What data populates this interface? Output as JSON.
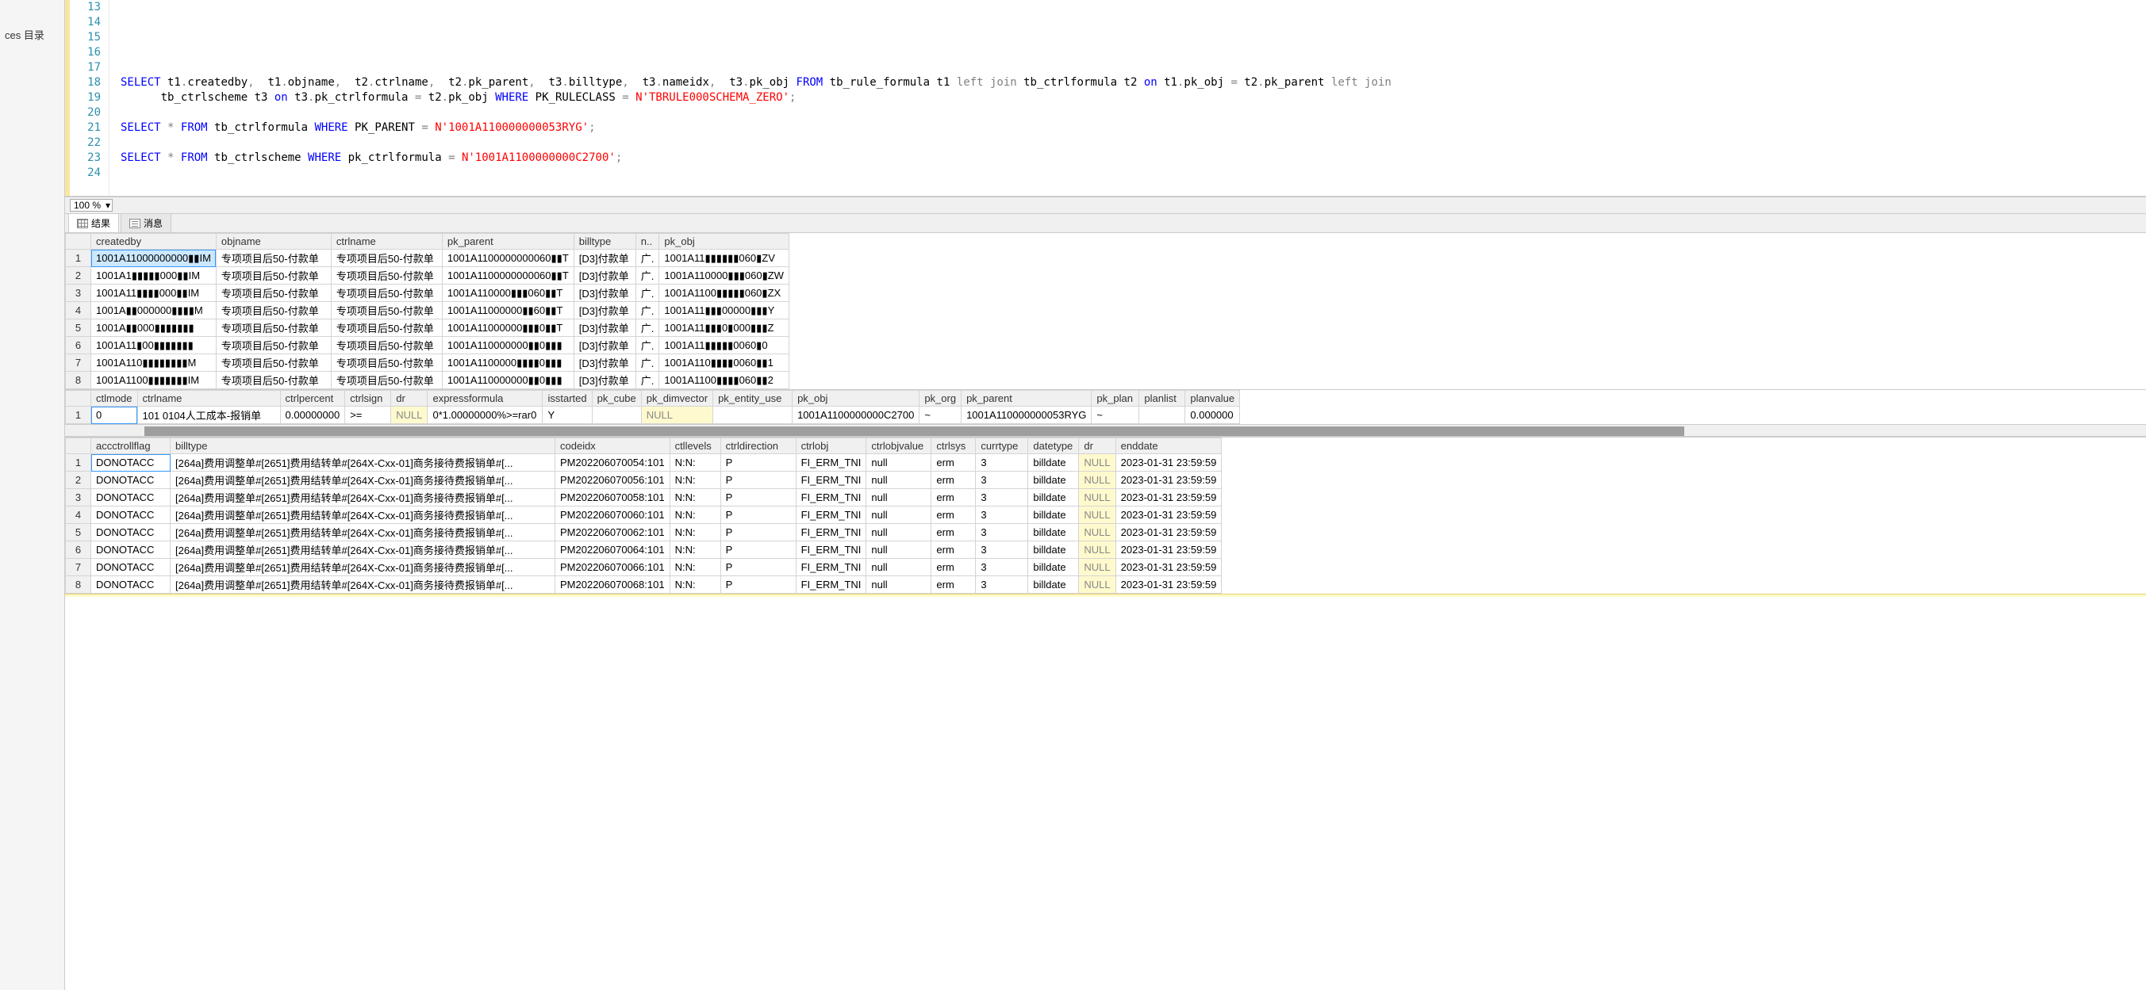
{
  "sidebar": {
    "item": "ces 目录"
  },
  "editor": {
    "first_line_no": 13,
    "lines": [
      "",
      "",
      "",
      "",
      "",
      {
        "type": "sql",
        "tokens": [
          {
            "k": "kw",
            "t": "SELECT"
          },
          {
            "t": " t1"
          },
          {
            "k": "op",
            "t": "."
          },
          {
            "t": "createdby"
          },
          {
            "k": "op",
            "t": ","
          },
          {
            "t": "  t1"
          },
          {
            "k": "op",
            "t": "."
          },
          {
            "t": "objname"
          },
          {
            "k": "op",
            "t": ","
          },
          {
            "t": "  t2"
          },
          {
            "k": "op",
            "t": "."
          },
          {
            "t": "ctrlname"
          },
          {
            "k": "op",
            "t": ","
          },
          {
            "t": "  t2"
          },
          {
            "k": "op",
            "t": "."
          },
          {
            "t": "pk_parent"
          },
          {
            "k": "op",
            "t": ","
          },
          {
            "t": "  t3"
          },
          {
            "k": "op",
            "t": "."
          },
          {
            "t": "billtype"
          },
          {
            "k": "op",
            "t": ","
          },
          {
            "t": "  t3"
          },
          {
            "k": "op",
            "t": "."
          },
          {
            "t": "nameidx"
          },
          {
            "k": "op",
            "t": ","
          },
          {
            "t": "  t3"
          },
          {
            "k": "op",
            "t": "."
          },
          {
            "t": "pk_obj "
          },
          {
            "k": "kw",
            "t": "FROM"
          },
          {
            "t": " tb_rule_formula t1 "
          },
          {
            "k": "op",
            "t": "left join"
          },
          {
            "t": " tb_ctrlformula t2 "
          },
          {
            "k": "kw",
            "t": "on"
          },
          {
            "t": " t1"
          },
          {
            "k": "op",
            "t": "."
          },
          {
            "t": "pk_obj "
          },
          {
            "k": "op",
            "t": "="
          },
          {
            "t": " t2"
          },
          {
            "k": "op",
            "t": "."
          },
          {
            "t": "pk_parent "
          },
          {
            "k": "op",
            "t": "left join"
          }
        ]
      },
      {
        "type": "cont",
        "tokens": [
          {
            "t": "      tb_ctrlscheme t3 "
          },
          {
            "k": "kw",
            "t": "on"
          },
          {
            "t": " t3"
          },
          {
            "k": "op",
            "t": "."
          },
          {
            "t": "pk_ctrlformula "
          },
          {
            "k": "op",
            "t": "="
          },
          {
            "t": " t2"
          },
          {
            "k": "op",
            "t": "."
          },
          {
            "t": "pk_obj "
          },
          {
            "k": "kw",
            "t": "WHERE"
          },
          {
            "t": " PK_RULECLASS "
          },
          {
            "k": "op",
            "t": "="
          },
          {
            "t": " "
          },
          {
            "k": "str",
            "t": "N'TBRULE000SCHEMA_ZERO'"
          },
          {
            "k": "op",
            "t": ";"
          }
        ]
      },
      "",
      {
        "type": "sql",
        "tokens": [
          {
            "k": "kw",
            "t": "SELECT"
          },
          {
            "t": " "
          },
          {
            "k": "op",
            "t": "*"
          },
          {
            "t": " "
          },
          {
            "k": "kw",
            "t": "FROM"
          },
          {
            "t": " tb_ctrlformula "
          },
          {
            "k": "kw",
            "t": "WHERE"
          },
          {
            "t": " PK_PARENT "
          },
          {
            "k": "op",
            "t": "="
          },
          {
            "t": " "
          },
          {
            "k": "str",
            "t": "N'1001A110000000053RYG'"
          },
          {
            "k": "op",
            "t": ";"
          }
        ]
      },
      "",
      {
        "type": "sql",
        "tokens": [
          {
            "k": "kw",
            "t": "SELECT"
          },
          {
            "t": " "
          },
          {
            "k": "op",
            "t": "*"
          },
          {
            "t": " "
          },
          {
            "k": "kw",
            "t": "FROM"
          },
          {
            "t": " tb_ctrlscheme "
          },
          {
            "k": "kw",
            "t": "WHERE"
          },
          {
            "t": " pk_ctrlformula "
          },
          {
            "k": "op",
            "t": "="
          },
          {
            "t": " "
          },
          {
            "k": "str",
            "t": "N'1001A1100000000C2700'"
          },
          {
            "k": "op",
            "t": ";"
          }
        ]
      },
      "",
      ""
    ],
    "line19_in_gutter": 19,
    "zoom": "100 %"
  },
  "tabs": {
    "results": "结果",
    "messages": "消息"
  },
  "grid1": {
    "cols": [
      "createdby",
      "objname",
      "ctrlname",
      "pk_parent",
      "billtype",
      "n..",
      "pk_obj"
    ],
    "widths": [
      150,
      145,
      140,
      150,
      78,
      22,
      148
    ],
    "rows": [
      [
        "1001A11000000000▮▮IM",
        "专项项目后50-付款单",
        "专项项目后50-付款单",
        "1001A1100000000060▮▮T",
        "[D3]付款单",
        "广.",
        "1001A11▮▮▮▮▮▮060▮ZV"
      ],
      [
        "1001A1▮▮▮▮▮000▮▮IM",
        "专项项目后50-付款单",
        "专项项目后50-付款单",
        "1001A1100000000060▮▮T",
        "[D3]付款单",
        "广.",
        "1001A110000▮▮▮060▮ZW"
      ],
      [
        "1001A11▮▮▮▮000▮▮IM",
        "专项项目后50-付款单",
        "专项项目后50-付款单",
        "1001A110000▮▮▮060▮▮T",
        "[D3]付款单",
        "广.",
        "1001A1100▮▮▮▮▮060▮ZX"
      ],
      [
        "1001A▮▮000000▮▮▮▮M",
        "专项项目后50-付款单",
        "专项项目后50-付款单",
        "1001A11000000▮▮60▮▮T",
        "[D3]付款单",
        "广.",
        "1001A11▮▮▮00000▮▮▮Y"
      ],
      [
        "1001A▮▮000▮▮▮▮▮▮▮",
        "专项项目后50-付款单",
        "专项项目后50-付款单",
        "1001A11000000▮▮▮0▮▮T",
        "[D3]付款单",
        "广.",
        "1001A11▮▮▮0▮000▮▮▮Z"
      ],
      [
        "1001A11▮00▮▮▮▮▮▮▮",
        "专项项目后50-付款单",
        "专项项目后50-付款单",
        "1001A110000000▮▮0▮▮▮",
        "[D3]付款单",
        "广.",
        "1001A11▮▮▮▮▮0060▮0"
      ],
      [
        "1001A110▮▮▮▮▮▮▮▮M",
        "专项项目后50-付款单",
        "专项项目后50-付款单",
        "1001A1100000▮▮▮▮0▮▮▮",
        "[D3]付款单",
        "广.",
        "1001A110▮▮▮▮0060▮▮1"
      ],
      [
        "1001A1100▮▮▮▮▮▮▮IM",
        "专项项目后50-付款单",
        "专项项目后50-付款单",
        "1001A110000000▮▮0▮▮▮",
        "[D3]付款单",
        "广.",
        "1001A1100▮▮▮▮060▮▮2"
      ]
    ]
  },
  "grid2": {
    "cols": [
      "ctlmode",
      "ctrlname",
      "ctrlpercent",
      "ctrlsign",
      "dr",
      "expressformula",
      "isstarted",
      "pk_cube",
      "pk_dimvector",
      "pk_entity_use",
      "pk_obj",
      "pk_org",
      "pk_parent",
      "pk_plan",
      "planlist",
      "planvalue"
    ],
    "widths": [
      52,
      180,
      75,
      58,
      40,
      145,
      62,
      60,
      90,
      100,
      150,
      44,
      150,
      60,
      58,
      60
    ],
    "rows": [
      [
        "0",
        "101 0104人工成本-报销单",
        "0.00000000",
        ">=",
        "NULL",
        "0*1.00000000%>=rar0",
        "Y",
        "",
        "NULL",
        "",
        "1001A1100000000C2700",
        "~",
        "1001A110000000053RYG",
        "~",
        "",
        "0.000000"
      ]
    ]
  },
  "grid3": {
    "cols": [
      "accctrollflag",
      "billtype",
      "codeidx",
      "ctllevels",
      "ctrldirection",
      "ctrlobj",
      "ctrlobjvalue",
      "ctrlsys",
      "currtype",
      "datetype",
      "dr",
      "enddate"
    ],
    "widths": [
      100,
      485,
      134,
      64,
      95,
      80,
      82,
      56,
      66,
      64,
      40,
      130
    ],
    "rows": [
      [
        "DONOTACC",
        "[264a]费用调整单#[2651]费用结转单#[264X-Cxx-01]商务接待费报销单#[...",
        "PM202206070054:101",
        "N:N:",
        "P",
        "FI_ERM_TNI",
        "null",
        "erm",
        "3",
        "billdate",
        "NULL",
        "2023-01-31 23:59:59"
      ],
      [
        "DONOTACC",
        "[264a]费用调整单#[2651]费用结转单#[264X-Cxx-01]商务接待费报销单#[...",
        "PM202206070056:101",
        "N:N:",
        "P",
        "FI_ERM_TNI",
        "null",
        "erm",
        "3",
        "billdate",
        "NULL",
        "2023-01-31 23:59:59"
      ],
      [
        "DONOTACC",
        "[264a]费用调整单#[2651]费用结转单#[264X-Cxx-01]商务接待费报销单#[...",
        "PM202206070058:101",
        "N:N:",
        "P",
        "FI_ERM_TNI",
        "null",
        "erm",
        "3",
        "billdate",
        "NULL",
        "2023-01-31 23:59:59"
      ],
      [
        "DONOTACC",
        "[264a]费用调整单#[2651]费用结转单#[264X-Cxx-01]商务接待费报销单#[...",
        "PM202206070060:101",
        "N:N:",
        "P",
        "FI_ERM_TNI",
        "null",
        "erm",
        "3",
        "billdate",
        "NULL",
        "2023-01-31 23:59:59"
      ],
      [
        "DONOTACC",
        "[264a]费用调整单#[2651]费用结转单#[264X-Cxx-01]商务接待费报销单#[...",
        "PM202206070062:101",
        "N:N:",
        "P",
        "FI_ERM_TNI",
        "null",
        "erm",
        "3",
        "billdate",
        "NULL",
        "2023-01-31 23:59:59"
      ],
      [
        "DONOTACC",
        "[264a]费用调整单#[2651]费用结转单#[264X-Cxx-01]商务接待费报销单#[...",
        "PM202206070064:101",
        "N:N:",
        "P",
        "FI_ERM_TNI",
        "null",
        "erm",
        "3",
        "billdate",
        "NULL",
        "2023-01-31 23:59:59"
      ],
      [
        "DONOTACC",
        "[264a]费用调整单#[2651]费用结转单#[264X-Cxx-01]商务接待费报销单#[...",
        "PM202206070066:101",
        "N:N:",
        "P",
        "FI_ERM_TNI",
        "null",
        "erm",
        "3",
        "billdate",
        "NULL",
        "2023-01-31 23:59:59"
      ],
      [
        "DONOTACC",
        "[264a]费用调整单#[2651]费用结转单#[264X-Cxx-01]商务接待费报销单#[...",
        "PM202206070068:101",
        "N:N:",
        "P",
        "FI_ERM_TNI",
        "null",
        "erm",
        "3",
        "billdate",
        "NULL",
        "2023-01-31 23:59:59"
      ]
    ]
  }
}
